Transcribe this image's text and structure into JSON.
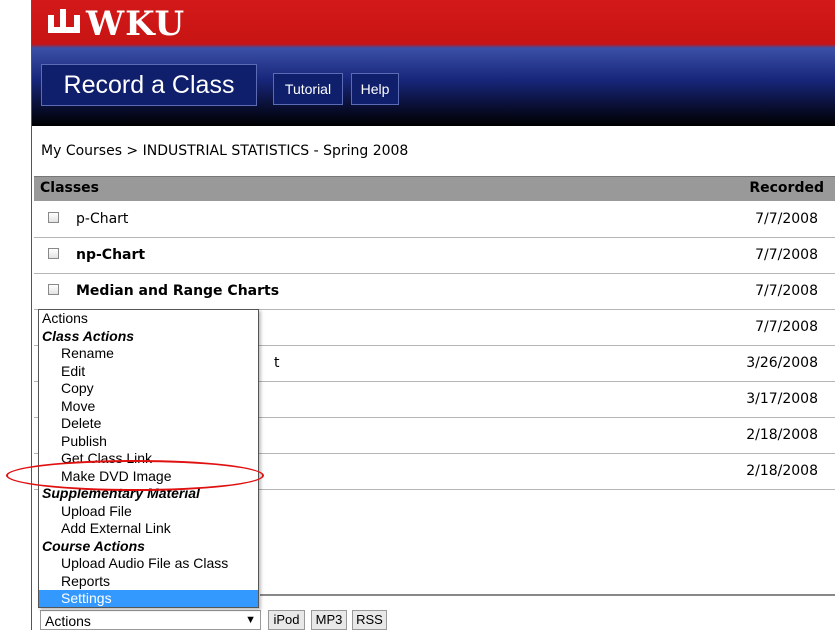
{
  "brand": {
    "logo_text": "WKU"
  },
  "app": {
    "title": "Record a Class"
  },
  "nav": {
    "tutorial": "Tutorial",
    "help": "Help"
  },
  "breadcrumb": "My Courses > INDUSTRIAL STATISTICS - Spring 2008",
  "table": {
    "col_classes": "Classes",
    "col_recorded": "Recorded",
    "rows": [
      {
        "name": "p-Chart",
        "date": "7/7/2008",
        "bold": false
      },
      {
        "name": "np-Chart",
        "date": "7/7/2008",
        "bold": true
      },
      {
        "name": "Median and Range Charts",
        "date": "7/7/2008",
        "bold": true
      },
      {
        "name": "",
        "date": "7/7/2008",
        "bold": false
      },
      {
        "name": "t",
        "date": "3/26/2008",
        "bold": false
      },
      {
        "name": "",
        "date": "3/17/2008",
        "bold": false
      },
      {
        "name": "",
        "date": "2/18/2008",
        "bold": false
      },
      {
        "name": "",
        "date": "2/18/2008",
        "bold": false
      }
    ]
  },
  "actions_menu": {
    "items": [
      {
        "label": "Actions",
        "kind": "plain"
      },
      {
        "label": "Class Actions",
        "kind": "head"
      },
      {
        "label": "Rename",
        "kind": "item"
      },
      {
        "label": "Edit",
        "kind": "item"
      },
      {
        "label": "Copy",
        "kind": "item"
      },
      {
        "label": "Move",
        "kind": "item"
      },
      {
        "label": "Delete",
        "kind": "item"
      },
      {
        "label": "Publish",
        "kind": "item"
      },
      {
        "label": "Get Class Link",
        "kind": "item"
      },
      {
        "label": "Make DVD Image",
        "kind": "item"
      },
      {
        "label": "Supplementary Material",
        "kind": "head"
      },
      {
        "label": "Upload File",
        "kind": "item"
      },
      {
        "label": "Add External Link",
        "kind": "item"
      },
      {
        "label": "Course Actions",
        "kind": "head"
      },
      {
        "label": "Upload Audio File as Class",
        "kind": "item"
      },
      {
        "label": "Reports",
        "kind": "item"
      },
      {
        "label": "Settings",
        "kind": "item",
        "selected": true
      }
    ]
  },
  "bottom_bar": {
    "select_value": "Actions",
    "ipod": "iPod",
    "mp3": "MP3",
    "rss": "RSS"
  },
  "colors": {
    "banner_red": "#c81414",
    "banner_blue": "#17267a",
    "menu_selected": "#3399ff",
    "annotation": "#e01010"
  }
}
